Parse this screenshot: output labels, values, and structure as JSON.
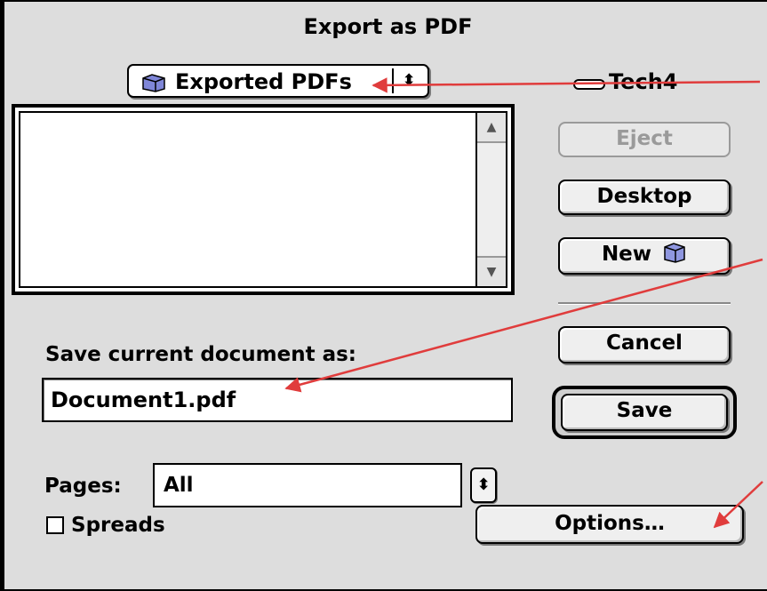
{
  "dialog": {
    "title": "Export as PDF"
  },
  "location": {
    "folder": "Exported PDFs",
    "disk": "Tech4"
  },
  "buttons": {
    "eject": "Eject",
    "desktop": "Desktop",
    "new_folder": "New",
    "cancel": "Cancel",
    "save": "Save",
    "options": "Options…"
  },
  "save_as": {
    "label": "Save current document as:",
    "value": "Document1.pdf"
  },
  "pages": {
    "label": "Pages:",
    "value": "All"
  },
  "spreads": {
    "label": "Spreads",
    "checked": false
  },
  "colors": {
    "annotation_arrow": "#e03c3c",
    "dialog_bg": "#dddddd"
  }
}
